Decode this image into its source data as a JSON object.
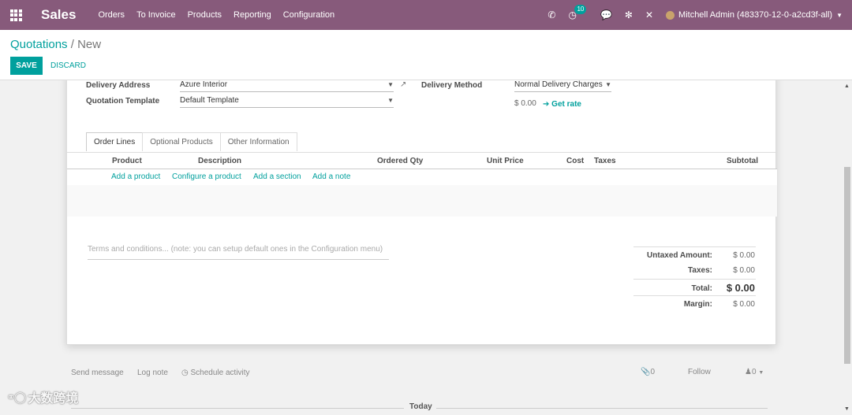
{
  "navbar": {
    "apps_icon": "grid-icon",
    "brand": "Sales",
    "menu": [
      "Orders",
      "To Invoice",
      "Products",
      "Reporting",
      "Configuration"
    ],
    "systray": {
      "phone_icon": "phone-icon",
      "activity_badge": "10",
      "chat_icon": "chat-icon",
      "bug_icon": "bug-icon",
      "close_icon": "close-icon",
      "user": "Mitchell Admin (483370-12-0-a2cd3f-all)"
    },
    "color": "#875a7b"
  },
  "breadcrumb": {
    "parent": "Quotations",
    "separator": "/",
    "current": "New"
  },
  "buttons": {
    "save": "SAVE",
    "discard": "DISCARD"
  },
  "form": {
    "delivery_address_label": "Delivery Address",
    "delivery_address_value": "Azure Interior",
    "quotation_template_label": "Quotation Template",
    "quotation_template_value": "Default Template",
    "delivery_method_label": "Delivery Method",
    "delivery_method_value": "Normal Delivery Charges",
    "delivery_amount": "$ 0.00",
    "get_rate": "Get rate"
  },
  "tabs": [
    "Order Lines",
    "Optional Products",
    "Other Information"
  ],
  "table": {
    "headers": [
      "Product",
      "Description",
      "Ordered Qty",
      "Unit Price",
      "Cost",
      "Taxes",
      "Subtotal"
    ],
    "add_links": [
      "Add a product",
      "Configure a product",
      "Add a section",
      "Add a note"
    ]
  },
  "terms_placeholder": "Terms and conditions... (note: you can setup default ones in the Configuration menu)",
  "totals": {
    "untaxed_label": "Untaxed Amount:",
    "untaxed_value": "$ 0.00",
    "taxes_label": "Taxes:",
    "taxes_value": "$ 0.00",
    "total_label": "Total:",
    "total_value": "$ 0.00",
    "margin_label": "Margin:",
    "margin_value": "$ 0.00"
  },
  "chatter": {
    "send_message": "Send message",
    "log_note": "Log note",
    "schedule_activity": "Schedule activity",
    "attachments": "0",
    "follow": "Follow",
    "followers": "0",
    "today": "Today"
  },
  "watermark": "大数跨境",
  "accent_color": "#00a09d"
}
